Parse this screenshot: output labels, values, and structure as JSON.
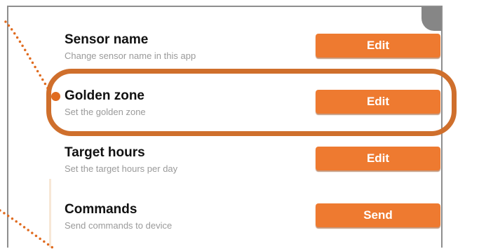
{
  "settings": {
    "rows": [
      {
        "title": "Sensor name",
        "subtitle": "Change sensor name in this app",
        "button": "Edit"
      },
      {
        "title": "Golden zone",
        "subtitle": "Set the golden zone",
        "button": "Edit"
      },
      {
        "title": "Target hours",
        "subtitle": "Set the target hours per day",
        "button": "Edit"
      },
      {
        "title": "Commands",
        "subtitle": "Send commands to device",
        "button": "Send"
      }
    ]
  },
  "colors": {
    "accent": "#ee7a30",
    "highlight": "#cf6f2c",
    "title": "#111111",
    "subtitle": "#9a9a9a",
    "frame": "#8e8e8e"
  },
  "icons": {
    "callout_marker": "callout-dot-icon"
  }
}
